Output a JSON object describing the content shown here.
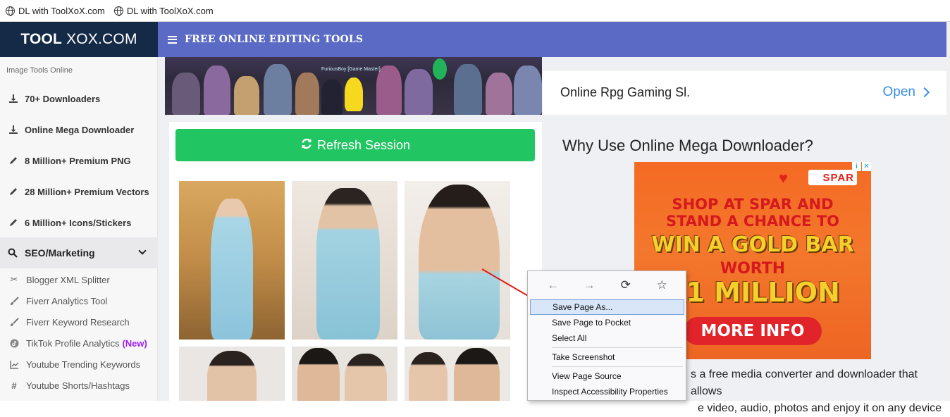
{
  "bookmarks": [
    {
      "label": "DL with ToolXoX.com",
      "icon": "globe-icon"
    },
    {
      "label": "DL with ToolXoX.com",
      "icon": "globe-icon"
    }
  ],
  "header": {
    "logo_bold": "TOOL",
    "logo_rest": "XOX.COM",
    "nav_title": "FREE ONLINE EDITING TOOLS",
    "nav_color": "#5b6ac4",
    "logo_bg": "#152a47"
  },
  "sidebar": {
    "caption": "Image Tools Online",
    "items": [
      {
        "label": "70+ Downloaders",
        "icon": "download-icon"
      },
      {
        "label": "Online Mega Downloader",
        "icon": "download-icon"
      },
      {
        "label": "8 Million+ Premium PNG",
        "icon": "pencil-icon"
      },
      {
        "label": "28 Million+ Premium Vectors",
        "icon": "pencil-icon"
      },
      {
        "label": "6 Million+ Icons/Stickers",
        "icon": "pencil-icon"
      }
    ],
    "section": {
      "label": "SEO/Marketing",
      "icon": "search-icon"
    },
    "sub_items": [
      {
        "label": "Blogger XML Splitter",
        "icon": "scissors-icon"
      },
      {
        "label": "Fiverr Analytics Tool",
        "icon": "brush-icon"
      },
      {
        "label": "Fiverr Keyword Research",
        "icon": "brush-icon"
      },
      {
        "label": "TikTok Profile Analytics",
        "badge": "(New)",
        "icon": "tiktok-icon"
      },
      {
        "label": "Youtube Trending Keywords",
        "icon": "chart-icon"
      },
      {
        "label": "Youtube Shorts/Hashtags",
        "icon": "hashtag-icon"
      }
    ]
  },
  "main": {
    "banner_tag": "FuriousBoy [Game Master]",
    "refresh_label": "Refresh Session",
    "refresh_color": "#21c562"
  },
  "right": {
    "ad_text": "Online Rpg Gaming Sl.",
    "ad_open": "Open",
    "why_title": "Why Use Online Mega Downloader?",
    "spar": {
      "brand": "SPAR",
      "line1": "SHOP AT SPAR AND",
      "line2": "STAND A CHANCE TO",
      "line3": "WIN A GOLD BAR",
      "line4": "WORTH",
      "line5": "R1 MILLION",
      "button": "MORE INFO"
    },
    "desc_line1": "s a free media converter and downloader that allows",
    "desc_line2": "e video, audio, photos and enjoy it on any device"
  },
  "context_menu": {
    "nav": [
      "←",
      "→",
      "⟳",
      "☆"
    ],
    "items": [
      {
        "label": "Save Page As...",
        "highlighted": true
      },
      {
        "label": "Save Page to Pocket"
      },
      {
        "label": "Select All"
      },
      {
        "label": "Take Screenshot"
      },
      {
        "label": "View Page Source"
      },
      {
        "label": "Inspect Accessibility Properties"
      }
    ]
  }
}
